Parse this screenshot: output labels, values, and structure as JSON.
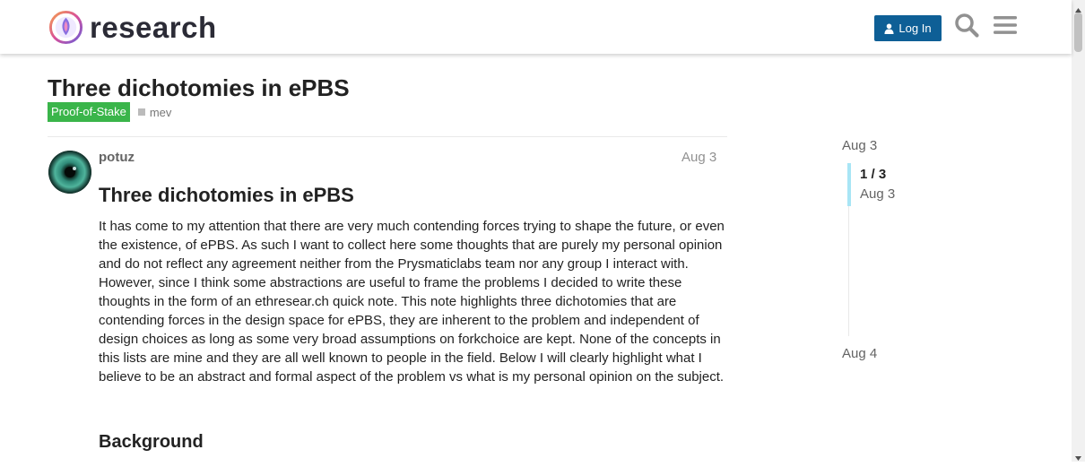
{
  "header": {
    "logo_text": "research",
    "login_label": "Log In",
    "icons": [
      "user-icon",
      "search-icon",
      "hamburger-menu-icon"
    ]
  },
  "topic": {
    "title": "Three dichotomies in ePBS",
    "category": "Proof-of-Stake",
    "tag": "mev"
  },
  "post": {
    "username": "potuz",
    "date": "Aug 3",
    "heading": "Three dichotomies in ePBS",
    "body": "It has come to my attention that there are very much contending forces trying to shape the future, or even the existence, of ePBS. As such I want to collect here some thoughts that are purely my personal opinion and do not reflect any agreement neither from the Prysmaticlabs team nor any group I interact with. However, since I think some abstractions are useful to frame the problems I decided to write these thoughts in the form of an ethresear.ch quick note. This note highlights three dichotomies that are contending forces in the design space for ePBS, they are inherent to the problem and independent of design choices as long as some very broad assumptions on forkchoice are kept. None of the concepts in this lists are mine and they are all well known to people in the field. Below I will clearly highlight what I believe to be an abstract and formal aspect of the problem vs what is my personal opinion on the subject.",
    "section_heading": "Background"
  },
  "timeline": {
    "start_date": "Aug 3",
    "position": "1 / 3",
    "position_date": "Aug 3",
    "end_date": "Aug 4"
  },
  "colors": {
    "primary": "#0e5f96",
    "category": "#3ab54a",
    "timeline_handle": "#a8e5f5"
  }
}
